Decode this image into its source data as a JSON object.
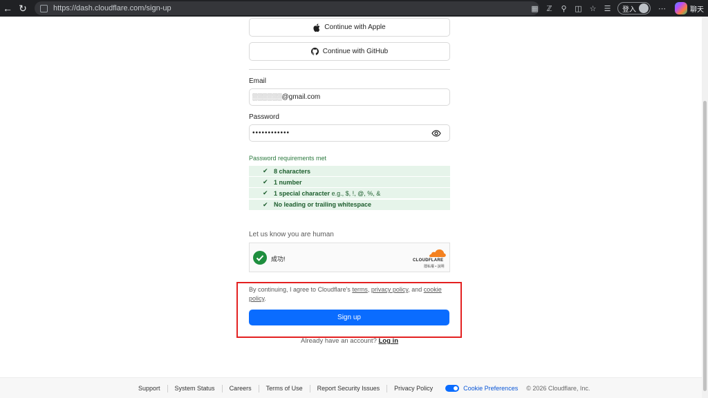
{
  "browser": {
    "url": "https://dash.cloudflare.com/sign-up",
    "sign_in_label": "登入",
    "chat_label": "聊天"
  },
  "sso": {
    "apple_label": "Continue with Apple",
    "github_label": "Continue with GitHub"
  },
  "form": {
    "email_label": "Email",
    "email_value": "░░░░░░@gmail.com",
    "password_label": "Password",
    "password_value": "••••••••••••",
    "requirements_title": "Password requirements met",
    "requirements": [
      {
        "strong": "8 characters",
        "rest": ""
      },
      {
        "strong": "1 number",
        "rest": ""
      },
      {
        "strong": "1 special character",
        "rest": " e.g., $, !, @, %, &"
      },
      {
        "strong": "No leading or trailing whitespace",
        "rest": ""
      }
    ],
    "human_label": "Let us know you are human",
    "turnstile_status": "成功!",
    "turnstile_brand": "CLOUDFLARE",
    "turnstile_links": "隱私權 • 說明",
    "terms_prefix": "By continuing, I agree to Cloudflare's ",
    "terms_link": "terms",
    "terms_sep": ", ",
    "privacy_link": "privacy policy",
    "terms_and": ", and ",
    "cookie_link_a": "cookie",
    "cookie_link_b": "policy",
    "terms_end": ".",
    "signup_label": "Sign up",
    "login_prompt": "Already have an account? ",
    "login_link": "Log in"
  },
  "footer": {
    "support": "Support",
    "system_status": "System Status",
    "careers": "Careers",
    "terms_of_use": "Terms of Use",
    "report_security": "Report Security Issues",
    "privacy_policy": "Privacy Policy",
    "cookie_preferences": "Cookie Preferences",
    "copyright": "© 2026 Cloudflare, Inc."
  },
  "colors": {
    "accent": "#0a6cff",
    "success": "#1e8e3e",
    "highlight": "#e32020",
    "cloudflare_orange": "#f48120"
  }
}
